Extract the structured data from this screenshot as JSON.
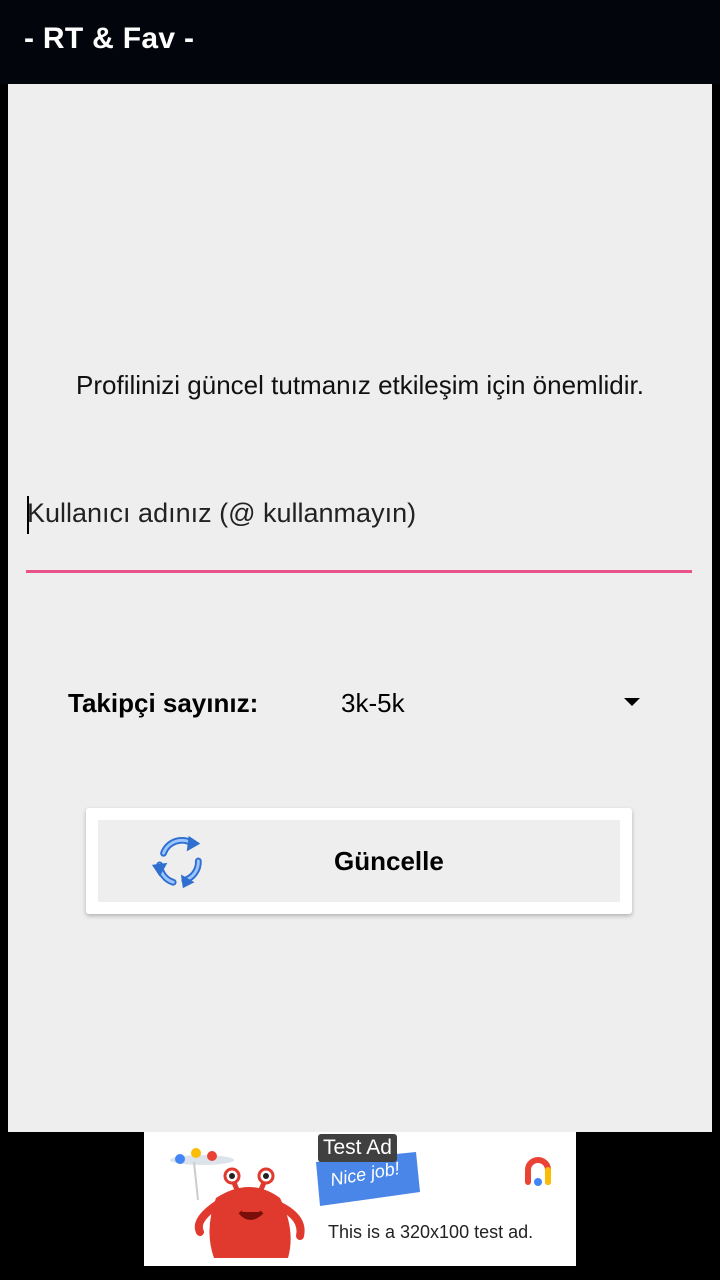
{
  "app": {
    "title": "- RT & Fav -"
  },
  "main": {
    "info_text": "Profilinizi güncel tutmanız etkileşim için önemlidir.",
    "username": {
      "placeholder": "Kullanıcı adınız (@ kullanmayın)",
      "value": ""
    },
    "followers": {
      "label": "Takipçi sayınız:",
      "selected": "3k-5k"
    },
    "update_button": {
      "label": "Güncelle",
      "icon": "refresh-icon"
    }
  },
  "ad": {
    "badge": "Test Ad",
    "flag_text": "Nice job!",
    "text": "This is a 320x100 test ad."
  },
  "colors": {
    "accent": "#e9538a",
    "app_bar": "#02050c",
    "background": "#eeeeee"
  }
}
